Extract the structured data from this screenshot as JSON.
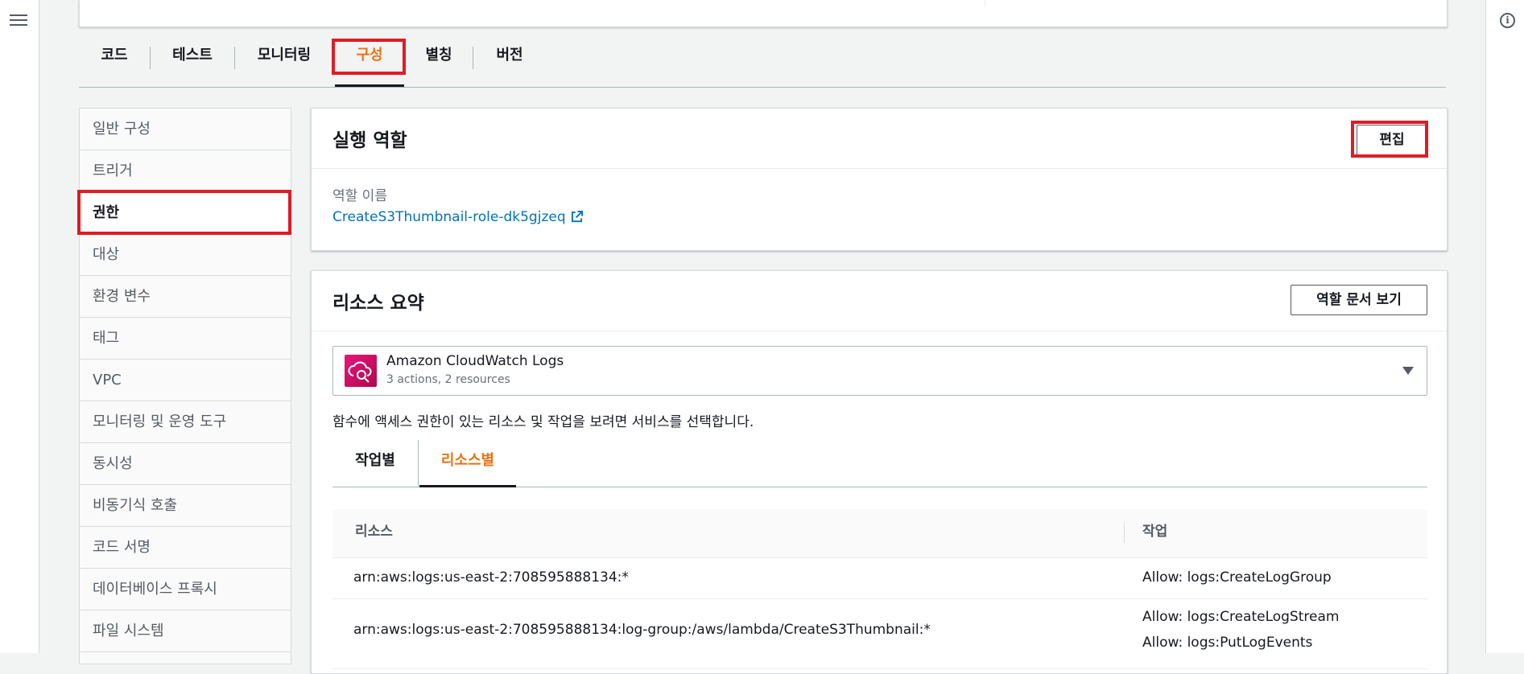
{
  "main_tabs": [
    "코드",
    "테스트",
    "모니터링",
    "구성",
    "별칭",
    "버전"
  ],
  "side_nav": [
    "일반 구성",
    "트리거",
    "권한",
    "대상",
    "환경 변수",
    "태그",
    "VPC",
    "모니터링 및 운영 도구",
    "동시성",
    "비동기식 호출",
    "코드 서명",
    "데이터베이스 프록시",
    "파일 시스템"
  ],
  "execution_role": {
    "title": "실행 역할",
    "edit_label": "편집",
    "role_name_label": "역할 이름",
    "role_name": "CreateS3Thumbnail-role-dk5gjzeq"
  },
  "resource_summary": {
    "title": "리소스 요약",
    "view_doc_label": "역할 문서 보기",
    "service": {
      "name": "Amazon CloudWatch Logs",
      "detail": "3 actions, 2 resources"
    },
    "description": "함수에 액세스 권한이 있는 리소스 및 작업을 보려면 서비스를 선택합니다.",
    "tabs": [
      "작업별",
      "리소스별"
    ],
    "table": {
      "headers": [
        "리소스",
        "작업"
      ],
      "rows": [
        {
          "resource": "arn:aws:logs:us-east-2:708595888134:*",
          "actions": [
            "Allow: logs:CreateLogGroup"
          ]
        },
        {
          "resource": "arn:aws:logs:us-east-2:708595888134:log-group:/aws/lambda/CreateS3Thumbnail:*",
          "actions": [
            "Allow: logs:CreateLogStream",
            "Allow: logs:PutLogEvents"
          ]
        }
      ]
    }
  },
  "colors": {
    "accent": "#ec7211",
    "link": "#0073bb",
    "highlight": "#e01b24"
  }
}
